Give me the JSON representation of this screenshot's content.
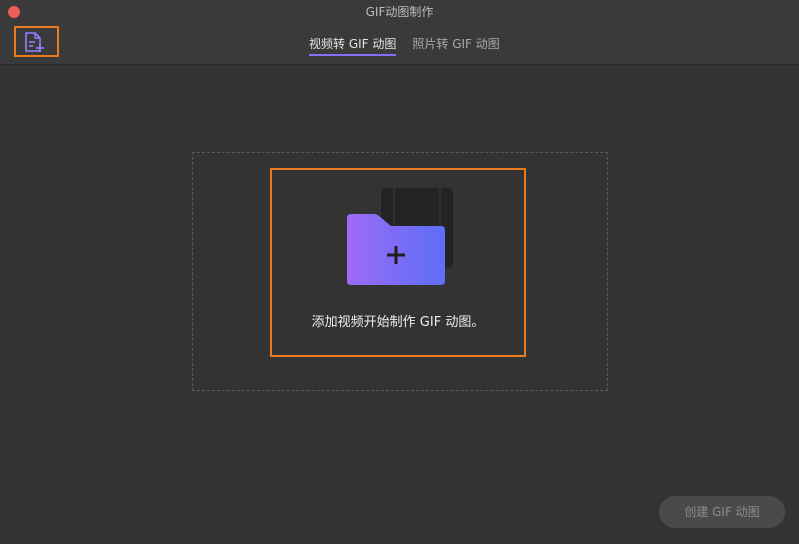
{
  "window": {
    "title": "GIF动图制作"
  },
  "header": {
    "tabs": [
      {
        "label": "视频转 GIF 动图",
        "active": true
      },
      {
        "label": "照片转 GIF 动图",
        "active": false
      }
    ]
  },
  "main": {
    "prompt": "添加视频开始制作 GIF 动图。"
  },
  "footer": {
    "create_label": "创建 GIF 动图"
  },
  "icons": {
    "add_file": "file-add-icon",
    "folder": "folder-add-icon",
    "film": "film-strip-icon"
  },
  "colors": {
    "accent": "#8b6cff",
    "highlight": "#ea7a1c",
    "close": "#ec5f59"
  }
}
